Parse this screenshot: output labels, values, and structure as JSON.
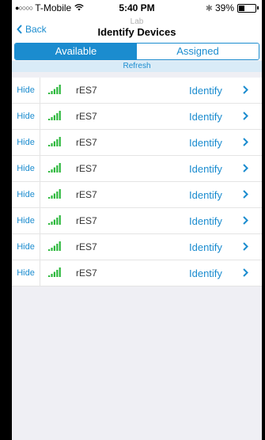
{
  "status_bar": {
    "carrier": "T-Mobile",
    "time": "5:40 PM",
    "battery_percent": "39%",
    "battery_level": 0.39,
    "icons": [
      "signal-dots-icon",
      "wifi-icon",
      "bluetooth-icon",
      "battery-icon"
    ]
  },
  "nav": {
    "back_label": "Back",
    "subtitle": "Lab",
    "title": "Identify Devices"
  },
  "tabs": [
    {
      "label": "Available",
      "active": true
    },
    {
      "label": "Assigned",
      "active": false
    }
  ],
  "refresh_label": "Refresh",
  "colors": {
    "accent": "#1b8ccf",
    "signal_green": "#2db83d",
    "background": "#efeff4"
  },
  "devices": [
    {
      "hide_label": "Hide",
      "name": "rES7",
      "identify_label": "Identify"
    },
    {
      "hide_label": "Hide",
      "name": "rES7",
      "identify_label": "Identify"
    },
    {
      "hide_label": "Hide",
      "name": "rES7",
      "identify_label": "Identify"
    },
    {
      "hide_label": "Hide",
      "name": "rES7",
      "identify_label": "Identify"
    },
    {
      "hide_label": "Hide",
      "name": "rES7",
      "identify_label": "Identify"
    },
    {
      "hide_label": "Hide",
      "name": "rES7",
      "identify_label": "Identify"
    },
    {
      "hide_label": "Hide",
      "name": "rES7",
      "identify_label": "Identify"
    },
    {
      "hide_label": "Hide",
      "name": "rES7",
      "identify_label": "Identify"
    }
  ]
}
